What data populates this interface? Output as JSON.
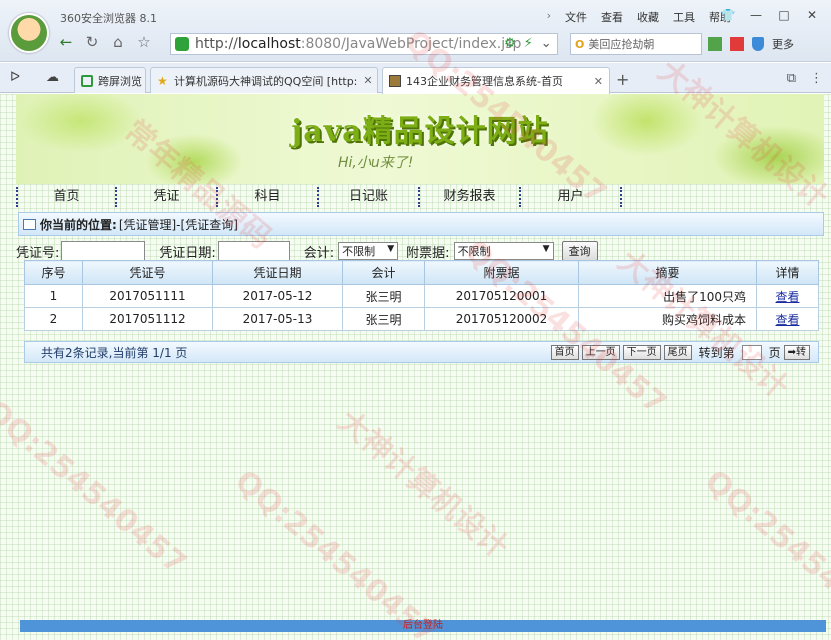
{
  "browser": {
    "app_name": "360安全浏览器 8.1",
    "menu": [
      "文件",
      "查看",
      "收藏",
      "工具",
      "帮助"
    ],
    "address": {
      "host_prefix": "http://",
      "host": "localhost",
      "rest": ":8080/JavaWebProject/index.jsp"
    },
    "search_text": "美回应抢劫朝",
    "more_label": "更多",
    "tabs": [
      {
        "label": "跨屏浏览"
      },
      {
        "label": "计算机源码大神调试的QQ空间 [http:"
      },
      {
        "label": "143企业财务管理信息系统-首页"
      }
    ]
  },
  "site": {
    "banner_title": "java精品设计网站",
    "banner_sub": "Hi,小u来了!",
    "nav": [
      "首页",
      "凭证",
      "科目",
      "日记账",
      "财务报表",
      "用户"
    ],
    "location_label": "你当前的位置:",
    "location_path": "[凭证管理]-[凭证查询]"
  },
  "filter": {
    "voucher_no_label": "凭证号:",
    "voucher_date_label": "凭证日期:",
    "accountant_label": "会计:",
    "accountant_value": "不限制",
    "attachment_label": "附票据:",
    "attachment_value": "不限制",
    "query_button": "查询"
  },
  "table": {
    "headers": [
      "序号",
      "凭证号",
      "凭证日期",
      "会计",
      "附票据",
      "摘要",
      "详情"
    ],
    "rows": [
      [
        "1",
        "2017051111",
        "2017-05-12",
        "张三明",
        "201705120001",
        "出售了100只鸡",
        "查看"
      ],
      [
        "2",
        "2017051112",
        "2017-05-13",
        "张三明",
        "201705120002",
        "购买鸡饲料成本",
        "查看"
      ]
    ]
  },
  "pager": {
    "info": "共有2条记录,当前第 1/1 页",
    "first": "首页",
    "prev": "上一页",
    "next": "下一页",
    "last": "尾页",
    "goto_label": "转到第",
    "page_unit": "页",
    "go": "➡转"
  },
  "footer": {
    "label": "后台登陆"
  },
  "watermark": [
    "大神计算机设计",
    "QQ:254540457",
    "常年精品源码"
  ],
  "colors": {
    "banner_title": "#7dae15",
    "header_bg": "#cfe5f6",
    "footer_bg": "#4f94d9",
    "link": "#1a2ca0"
  }
}
